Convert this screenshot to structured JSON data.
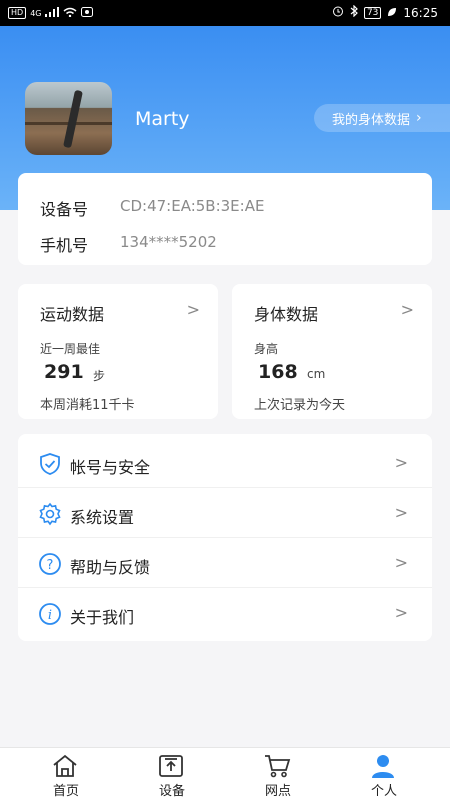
{
  "status_bar": {
    "left_badges": [
      "HD",
      "4G"
    ],
    "battery": "73",
    "time": "16:25"
  },
  "profile": {
    "username": "Marty",
    "body_data_button": "我的身体数据"
  },
  "device": {
    "device_label": "设备号",
    "device_value": "CD:47:EA:5B:3E:AE",
    "phone_label": "手机号",
    "phone_value": "134****5202"
  },
  "sport": {
    "title": "运动数据",
    "sub": "近一周最佳",
    "value": "291",
    "unit": "步",
    "footer": "本周消耗11千卡"
  },
  "body": {
    "title": "身体数据",
    "sub": "身高",
    "value": "168",
    "unit": "cm",
    "footer": "上次记录为今天"
  },
  "menu": {
    "items": [
      {
        "label": "帐号与安全",
        "icon": "shield-check-icon"
      },
      {
        "label": "系统设置",
        "icon": "gear-icon"
      },
      {
        "label": "帮助与反馈",
        "icon": "help-icon"
      },
      {
        "label": "关于我们",
        "icon": "info-icon"
      }
    ]
  },
  "tabbar": {
    "items": [
      {
        "label": "首页",
        "icon": "home-icon"
      },
      {
        "label": "设备",
        "icon": "device-icon"
      },
      {
        "label": "网点",
        "icon": "cart-icon"
      },
      {
        "label": "个人",
        "icon": "person-icon"
      }
    ],
    "active_color": "#2d8cf0",
    "inactive_color": "#333333"
  },
  "colors": {
    "accent": "#3a8ef2",
    "icon_blue": "#2d8cf0"
  }
}
